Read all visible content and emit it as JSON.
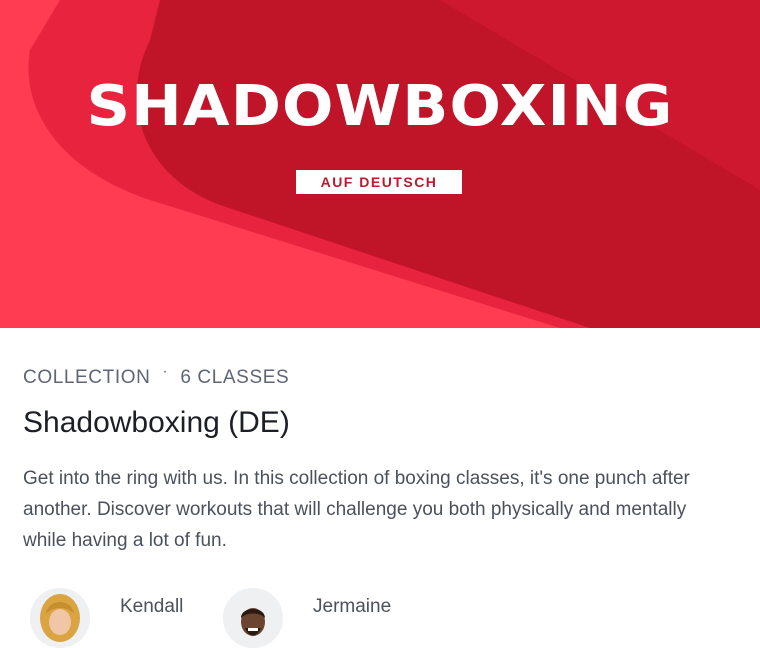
{
  "hero": {
    "title": "SHADOWBOXING",
    "badge": "AUF DEUTSCH",
    "colors": {
      "base": "#ff3c52",
      "mid": "#e8233e",
      "dark": "#c01429"
    }
  },
  "meta": {
    "type": "COLLECTION",
    "separator": "·",
    "count": "6 CLASSES"
  },
  "collection": {
    "title": "Shadowboxing (DE)",
    "description": "Get into the ring with us. In this collection of boxing classes, it's one punch after another. Discover workouts that will challenge you both physically and mentally while having a lot of fun."
  },
  "instructors": [
    {
      "name": "Kendall"
    },
    {
      "name": "Jermaine"
    }
  ]
}
